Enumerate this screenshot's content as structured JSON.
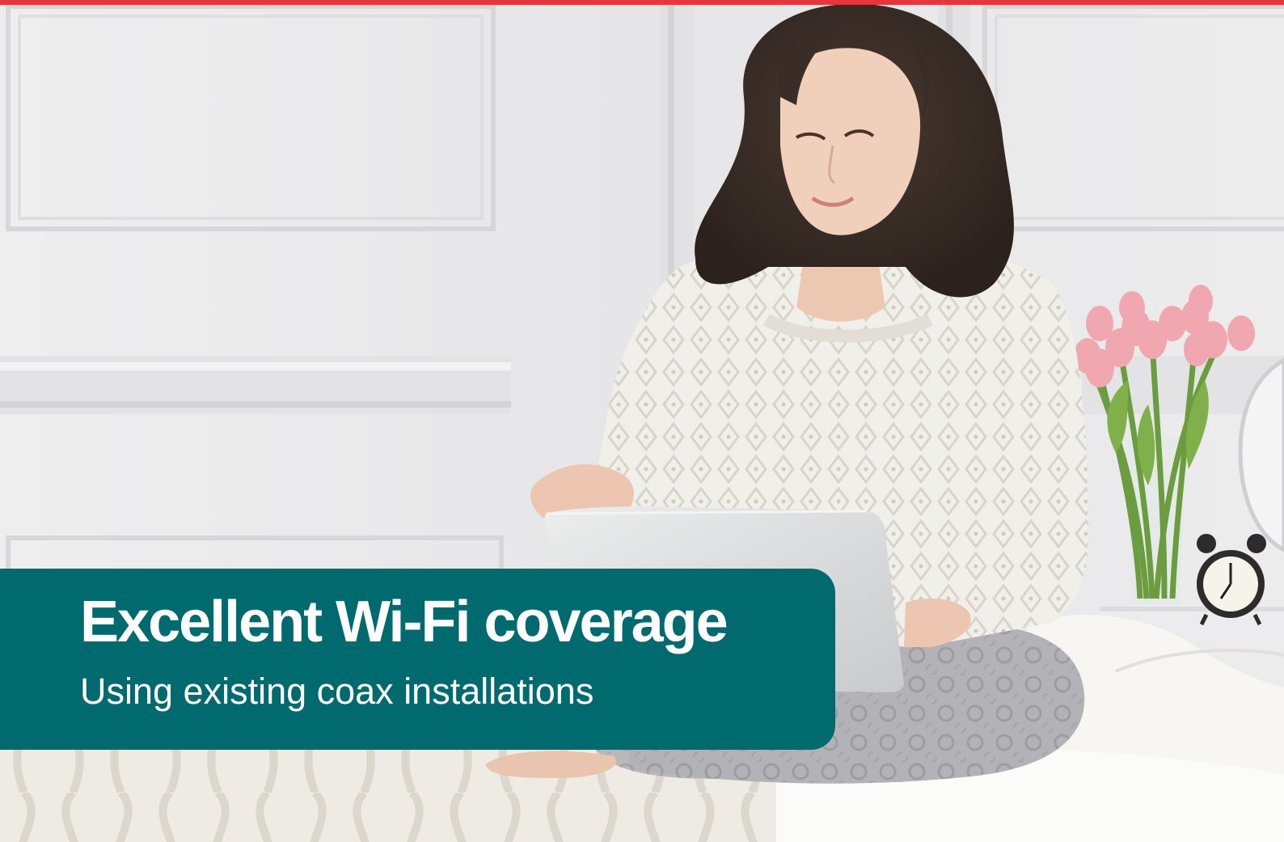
{
  "colors": {
    "accent_bar": "#e8343a",
    "banner_background": "#006a6f",
    "banner_text": "#ffffff"
  },
  "banner": {
    "title": "Excellent Wi-Fi coverage",
    "subtitle": "Using existing coax installations"
  }
}
